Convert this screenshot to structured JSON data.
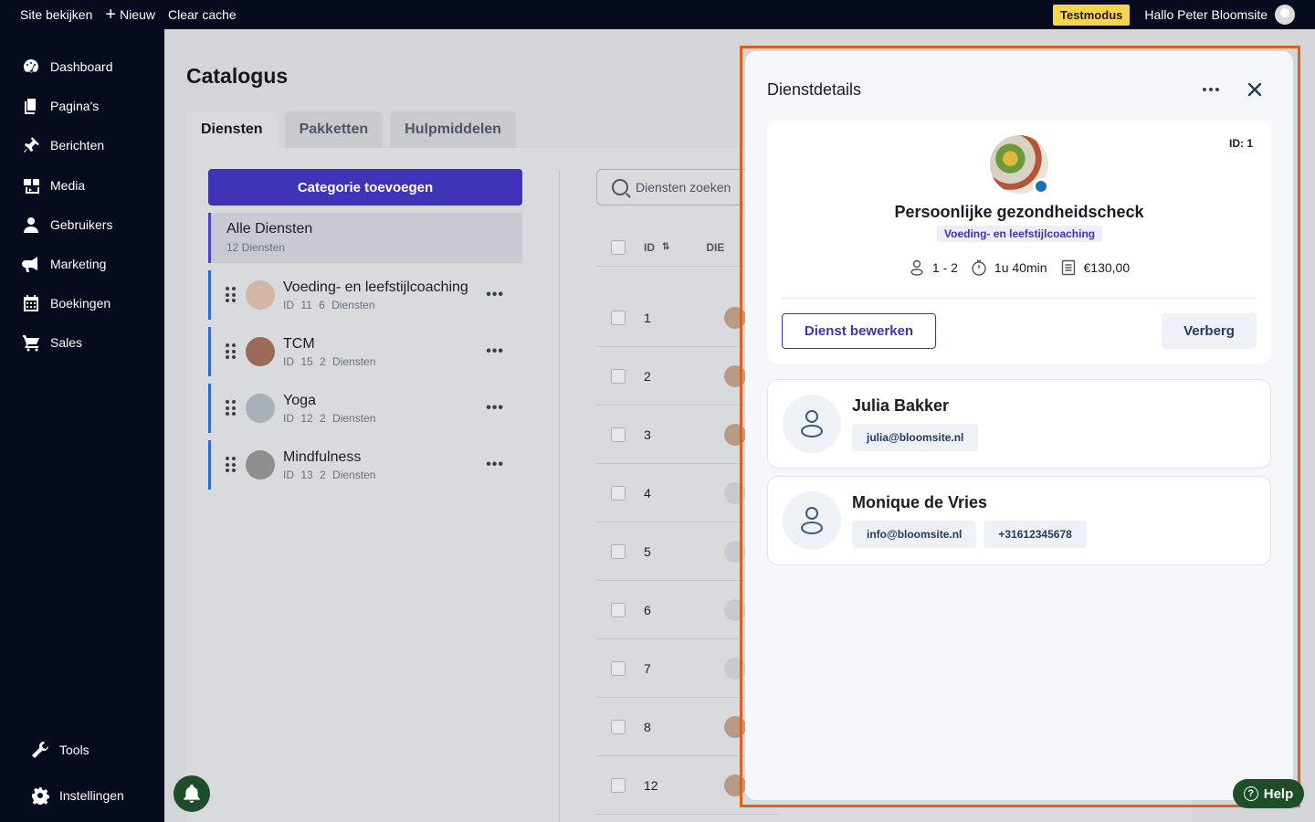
{
  "topbar": {
    "view_site": "Site bekijken",
    "new_label": "Nieuw",
    "clear_cache": "Clear cache",
    "test_mode": "Testmodus",
    "greeting": "Hallo Peter Bloomsite"
  },
  "sidebar": {
    "items": [
      {
        "label": "Dashboard",
        "icon": "dashboard-icon"
      },
      {
        "label": "Pagina's",
        "icon": "pages-icon"
      },
      {
        "label": "Berichten",
        "icon": "pin-icon"
      },
      {
        "label": "Media",
        "icon": "media-icon"
      },
      {
        "label": "Gebruikers",
        "icon": "user-icon"
      },
      {
        "label": "Marketing",
        "icon": "megaphone-icon"
      },
      {
        "label": "Boekingen",
        "icon": "calendar-icon"
      },
      {
        "label": "Sales",
        "icon": "cart-icon"
      }
    ],
    "bottom": [
      {
        "label": "Tools",
        "icon": "wrench-icon"
      },
      {
        "label": "Instellingen",
        "icon": "gear-icon"
      }
    ]
  },
  "main": {
    "title": "Catalogus",
    "tabs": [
      {
        "label": "Diensten",
        "active": true
      },
      {
        "label": "Pakketten",
        "active": false
      },
      {
        "label": "Hulpmiddelen",
        "active": false
      }
    ],
    "add_category": "Categorie toevoegen",
    "all_services": {
      "title": "Alle Diensten",
      "subtitle": "12 Diensten"
    },
    "categories": [
      {
        "name": "Voeding- en leefstijlcoaching",
        "meta": "ID 11 6 Diensten"
      },
      {
        "name": "TCM",
        "meta": "ID 15 2 Diensten"
      },
      {
        "name": "Yoga",
        "meta": "ID 12 2 Diensten"
      },
      {
        "name": "Mindfulness",
        "meta": "ID 13 2 Diensten"
      }
    ],
    "search_placeholder": "Diensten zoeken",
    "table": {
      "col_id": "ID",
      "col_service": "DIE",
      "rows": [
        "1",
        "2",
        "3",
        "4",
        "5",
        "6",
        "7",
        "8",
        "12"
      ]
    }
  },
  "drawer": {
    "title": "Dienstdetails",
    "id_label": "ID: 1",
    "service_name": "Persoonlijke gezondheidscheck",
    "category_badge": "Voeding- en leefstijlcoaching",
    "capacity": "1 - 2",
    "duration": "1u 40min",
    "price": "€130,00",
    "edit_button": "Dienst bewerken",
    "hide_button": "Verberg",
    "employees": [
      {
        "name": "Julia Bakker",
        "chips": [
          "julia@bloomsite.nl"
        ]
      },
      {
        "name": "Monique de Vries",
        "chips": [
          "info@bloomsite.nl",
          "+31612345678"
        ]
      }
    ]
  },
  "help_label": "Help",
  "colors": {
    "primary": "#3f33b8",
    "sidebar": "#070b1e",
    "highlight": "#d9621d",
    "help": "#1e4d2b",
    "testmode": "#fcd34d"
  }
}
